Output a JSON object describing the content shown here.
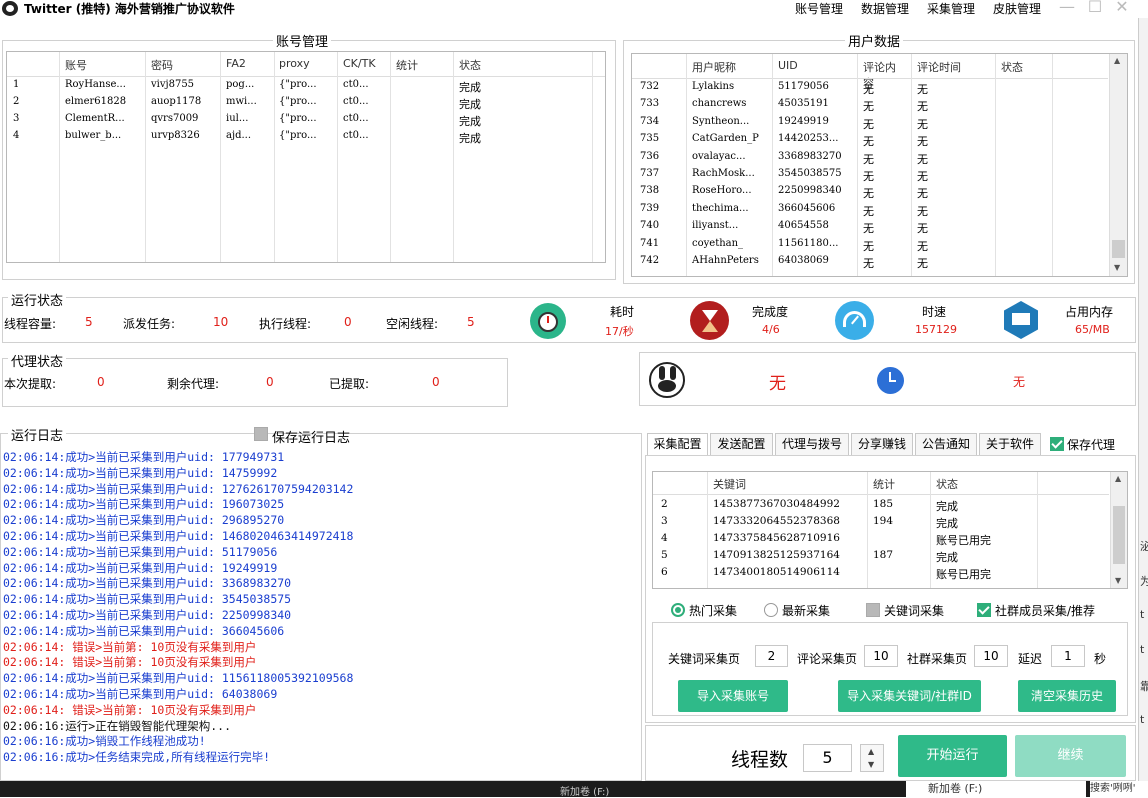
{
  "window": {
    "title": "Twitter (推特) 海外营销推广协议软件"
  },
  "menu": [
    "账号管理",
    "数据管理",
    "采集管理",
    "皮肤管理"
  ],
  "account_panel": {
    "title": "账号管理",
    "columns": [
      "账号",
      "密码",
      "FA2",
      "proxy",
      "CK/TK",
      "统计",
      "状态"
    ],
    "rows": [
      [
        "1",
        "RoyHanse...",
        "vivj8755",
        "pog...",
        "{\"pro...",
        "ct0...",
        "",
        "完成"
      ],
      [
        "2",
        "elmer61828",
        "auop1178",
        "mwi...",
        "{\"pro...",
        "ct0...",
        "",
        "完成"
      ],
      [
        "3",
        "ClementR...",
        "qvrs7009",
        "iul...",
        "{\"pro...",
        "ct0...",
        "",
        "完成"
      ],
      [
        "4",
        "bulwer_b...",
        "urvp8326",
        "ajd...",
        "{\"pro...",
        "ct0...",
        "",
        "完成"
      ]
    ]
  },
  "user_panel": {
    "title": "用户数据",
    "columns": [
      "用户昵称",
      "UID",
      "评论内容",
      "评论时间",
      "状态"
    ],
    "rows": [
      [
        "732",
        "Lylakins",
        "51179056",
        "无",
        "无"
      ],
      [
        "733",
        "chancrews",
        "45035191",
        "无",
        "无"
      ],
      [
        "734",
        "Syntheon...",
        "19249919",
        "无",
        "无"
      ],
      [
        "735",
        "CatGarden_P",
        "14420253...",
        "无",
        "无"
      ],
      [
        "736",
        "ovalayac...",
        "3368983270",
        "无",
        "无"
      ],
      [
        "737",
        "RachMosk...",
        "3545038575",
        "无",
        "无"
      ],
      [
        "738",
        "RoseHoro...",
        "2250998340",
        "无",
        "无"
      ],
      [
        "739",
        "thechima...",
        "366045606",
        "无",
        "无"
      ],
      [
        "740",
        "iliyanst...",
        "40654558",
        "无",
        "无"
      ],
      [
        "741",
        "coyethan_",
        "11561180...",
        "无",
        "无"
      ],
      [
        "742",
        "AHahnPeters",
        "64038069",
        "无",
        "无"
      ]
    ]
  },
  "run_status": {
    "title": "运行状态",
    "thread_capacity_label": "线程容量:",
    "thread_capacity": "5",
    "dispatch_label": "派发任务:",
    "dispatch": "10",
    "exec_label": "执行线程:",
    "exec": "0",
    "idle_label": "空闲线程:",
    "idle": "5",
    "elapsed_label": "耗时",
    "elapsed": "17/秒",
    "progress_label": "完成度",
    "progress": "4/6",
    "speed_label": "时速",
    "speed": "157129",
    "memory_label": "占用内存",
    "memory": "65/MB"
  },
  "proxy_status": {
    "title": "代理状态",
    "fetch_label": "本次提取:",
    "fetch": "0",
    "remain_label": "剩余代理:",
    "remain": "0",
    "fetched_label": "已提取:",
    "fetched": "0",
    "ext_value_1": "无",
    "ext_value_2": "无"
  },
  "log_panel": {
    "title": "运行日志",
    "save_label": "保存运行日志",
    "lines": [
      {
        "t": "02:06:14:成功>当前已采集到用户uid: 177949731",
        "c": "#1a3ecf"
      },
      {
        "t": "02:06:14:成功>当前已采集到用户uid: 14759992",
        "c": "#1a3ecf"
      },
      {
        "t": "02:06:14:成功>当前已采集到用户uid: 1276261707594203142",
        "c": "#1a3ecf"
      },
      {
        "t": "02:06:14:成功>当前已采集到用户uid: 196073025",
        "c": "#1a3ecf"
      },
      {
        "t": "02:06:14:成功>当前已采集到用户uid: 296895270",
        "c": "#1a3ecf"
      },
      {
        "t": "02:06:14:成功>当前已采集到用户uid: 1468020463414972418",
        "c": "#1a3ecf"
      },
      {
        "t": "02:06:14:成功>当前已采集到用户uid: 51179056",
        "c": "#1a3ecf"
      },
      {
        "t": "02:06:14:成功>当前已采集到用户uid: 19249919",
        "c": "#1a3ecf"
      },
      {
        "t": "02:06:14:成功>当前已采集到用户uid: 3368983270",
        "c": "#1a3ecf"
      },
      {
        "t": "02:06:14:成功>当前已采集到用户uid: 3545038575",
        "c": "#1a3ecf"
      },
      {
        "t": "02:06:14:成功>当前已采集到用户uid: 2250998340",
        "c": "#1a3ecf"
      },
      {
        "t": "02:06:14:成功>当前已采集到用户uid: 366045606",
        "c": "#1a3ecf"
      },
      {
        "t": "02:06:14: 错误>当前第: 10页没有采集到用户",
        "c": "#e0201a"
      },
      {
        "t": "02:06:14: 错误>当前第: 10页没有采集到用户",
        "c": "#e0201a"
      },
      {
        "t": "02:06:14:成功>当前已采集到用户uid: 1156118005392109568",
        "c": "#1a3ecf"
      },
      {
        "t": "02:06:14:成功>当前已采集到用户uid: 64038069",
        "c": "#1a3ecf"
      },
      {
        "t": "02:06:14: 错误>当前第: 10页没有采集到用户",
        "c": "#e0201a"
      },
      {
        "t": "02:06:16:运行>正在销毁智能代理架构...",
        "c": "#111111"
      },
      {
        "t": "02:06:16:成功>销毁工作线程池成功!",
        "c": "#1a3ecf"
      },
      {
        "t": "02:06:16:成功>任务结束完成,所有线程运行完毕!",
        "c": "#1a3ecf"
      }
    ]
  },
  "tabs": [
    "采集配置",
    "发送配置",
    "代理与拨号",
    "分享赚钱",
    "公告通知",
    "关于软件"
  ],
  "save_proxy_label": "保存代理",
  "keyword_table": {
    "columns": [
      "关键词",
      "统计",
      "状态"
    ],
    "rows": [
      [
        "2",
        "1453877367030484992",
        "185",
        "完成"
      ],
      [
        "3",
        "1473332064552378368",
        "194",
        "完成"
      ],
      [
        "4",
        "1473375845628710916",
        "",
        "账号已用完"
      ],
      [
        "5",
        "1470913825125937164",
        "187",
        "完成"
      ],
      [
        "6",
        "1473400180514906114",
        "",
        "账号已用完"
      ]
    ]
  },
  "collect_options": {
    "hot": "热门采集",
    "latest": "最新采集",
    "keyword": "关键词采集",
    "community": "社群成员采集/推荐"
  },
  "settings": {
    "kw_pages_label": "关键词采集页",
    "kw_pages": "2",
    "comment_pages_label": "评论采集页",
    "comment_pages": "10",
    "community_pages_label": "社群采集页",
    "community_pages": "10",
    "delay_label": "延迟",
    "delay": "1",
    "sec_label": "秒"
  },
  "buttons": {
    "import_accounts": "导入采集账号",
    "import_keywords": "导入采集关键词/社群ID",
    "clear_history": "清空采集历史",
    "start": "开始运行",
    "continue": "继续"
  },
  "threads": {
    "label": "线程数",
    "value": "5"
  },
  "taskbar": {
    "item1": "新加卷 (F:)",
    "item2": "新加卷 (F:)",
    "item3": "搜索'咧咧'"
  },
  "colors": {
    "accent": "#2fba89",
    "error": "#e0201a",
    "log_info": "#1a3ecf"
  }
}
